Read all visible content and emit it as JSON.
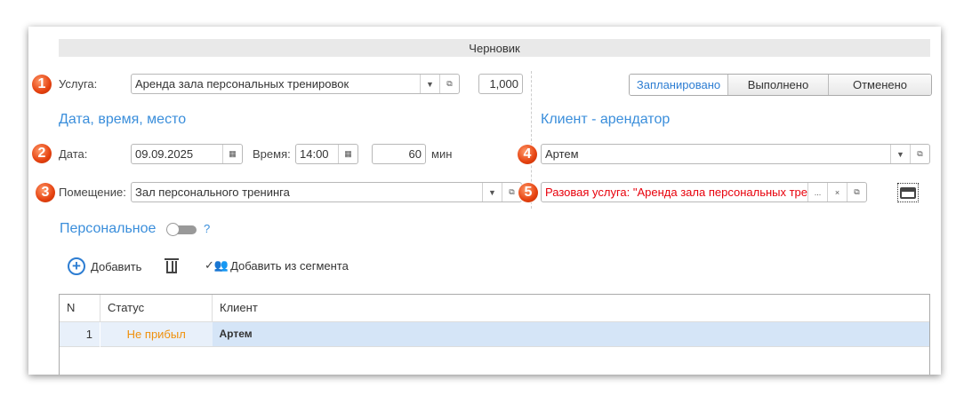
{
  "header": {
    "status_title": "Черновик"
  },
  "service": {
    "label": "Услуга:",
    "value": "Аренда зала персональных тренировок",
    "quantity": "1,000",
    "badge": "1"
  },
  "status_buttons": [
    {
      "label": "Запланировано",
      "active": true
    },
    {
      "label": "Выполнено"
    },
    {
      "label": "Отменено"
    }
  ],
  "sections": {
    "datetime": "Дата, время, место",
    "client": "Клиент - арендатор"
  },
  "date": {
    "label": "Дата:",
    "value": "09.09.2025",
    "badge": "2"
  },
  "time": {
    "label": "Время:",
    "value": "14:00"
  },
  "duration": {
    "value": "60",
    "unit": "мин"
  },
  "room": {
    "label": "Помещение:",
    "value": "Зал персонального тренинга",
    "badge": "3"
  },
  "client": {
    "value": "Артем",
    "badge": "4"
  },
  "subscription": {
    "value": "Разовая услуга: \"Аренда зала персональных тре",
    "badge": "5",
    "more": "...",
    "clear": "×",
    "color": "#e8000b"
  },
  "personal": {
    "label": "Персональное",
    "help": "?",
    "toggle_on": false
  },
  "toolbar": {
    "add": "Добавить",
    "add_segment": "Добавить из сегмента"
  },
  "table": {
    "columns": [
      "N",
      "Статус",
      "Клиент"
    ],
    "rows": [
      {
        "n": "1",
        "status": "Не прибыл",
        "client": "Артем"
      }
    ]
  },
  "colors": {
    "accent": "#3a8edb",
    "status_orange": "#f0900c",
    "selected_row": "#d5e5f7"
  }
}
